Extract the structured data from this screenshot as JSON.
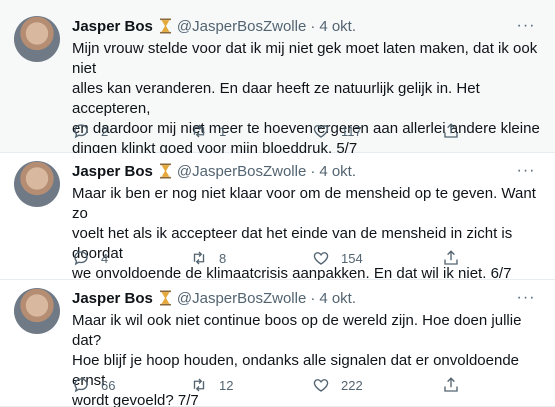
{
  "tweets": [
    {
      "name": "Jasper Bos",
      "handle": "@JasperBosZwolle",
      "separator": "·",
      "date": "4 okt.",
      "more": "···",
      "lines": [
        "Mijn vrouw stelde voor dat ik mij niet gek moet laten maken, dat ik ook niet",
        "alles kan veranderen. En daar heeft ze natuurlijk gelijk in. Het accepteren,",
        "en daardoor mij niet meer te hoeven ergeren aan allerlei andere kleine",
        "dingen klinkt goed voor mijn bloeddruk. 5/7"
      ],
      "replies": "2",
      "retweets": "1",
      "likes": "117"
    },
    {
      "name": "Jasper Bos",
      "handle": "@JasperBosZwolle",
      "separator": "·",
      "date": "4 okt.",
      "more": "···",
      "lines": [
        "Maar ik ben er nog niet klaar voor om de mensheid op te geven. Want zo",
        "voelt het als ik accepteer dat het einde van de mensheid in zicht is doordat",
        "we onvoldoende de klimaatcrisis aanpakken. En dat wil ik niet. 6/7"
      ],
      "replies": "4",
      "retweets": "8",
      "likes": "154"
    },
    {
      "name": "Jasper Bos",
      "handle": "@JasperBosZwolle",
      "separator": "·",
      "date": "4 okt.",
      "more": "···",
      "lines": [
        "Maar ik wil ook niet continue boos op de wereld zijn. Hoe doen jullie dat?",
        "Hoe blijf je hoop houden, ondanks alle signalen dat er onvoldoende ernst",
        "wordt gevoeld? 7/7"
      ],
      "replies": "66",
      "retweets": "12",
      "likes": "222"
    }
  ],
  "icons": {
    "reply": "reply-icon",
    "retweet": "retweet-icon",
    "like": "heart-icon",
    "share": "share-icon",
    "badge": "hourglass-icon"
  },
  "colors": {
    "text": "#0f1419",
    "secondary": "#536471",
    "highlight_bg": "#f7f9f9",
    "hourglass": "#e5a93b"
  }
}
